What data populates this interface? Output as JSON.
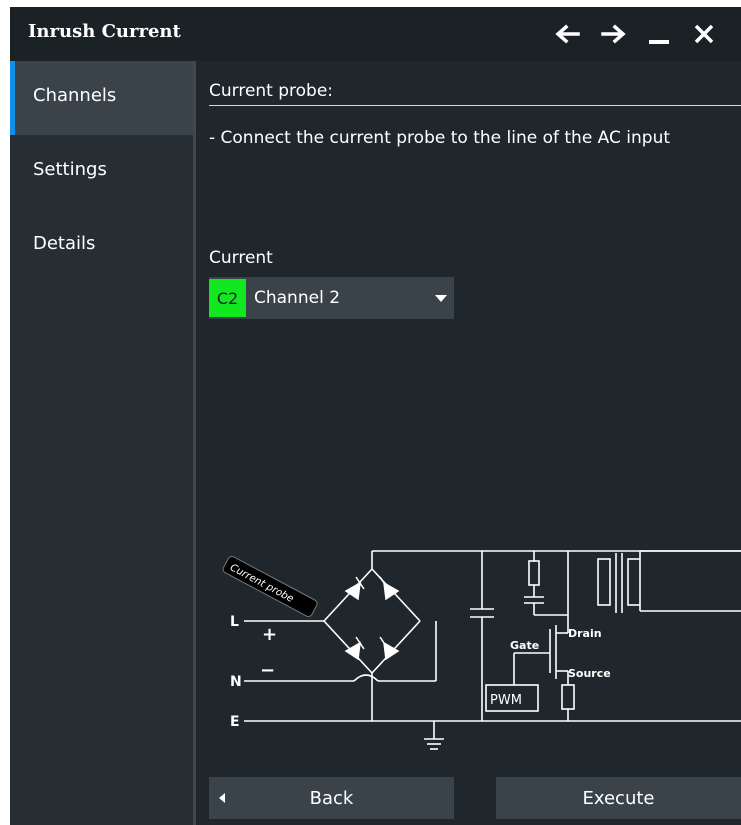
{
  "window": {
    "title": "Inrush Current",
    "controls": [
      "arrow-left-icon",
      "arrow-right-icon",
      "minimize-icon",
      "close-icon"
    ]
  },
  "sidebar": {
    "items": [
      {
        "label": "Channels",
        "active": true
      },
      {
        "label": "Settings",
        "active": false
      },
      {
        "label": "Details",
        "active": false
      }
    ]
  },
  "main": {
    "section_title": "Current probe:",
    "instruction": "- Connect the current probe to the line of the AC input",
    "current_label": "Current",
    "current_select": {
      "badge": "C2",
      "value": "Channel 2",
      "badge_color": "#11e81f"
    }
  },
  "diagram": {
    "probe_label": "Current probe",
    "terminal_l": "L",
    "terminal_n": "N",
    "terminal_e": "E",
    "plus": "+",
    "minus": "−",
    "gate": "Gate",
    "drain": "Drain",
    "source": "Source",
    "pwm": "PWM"
  },
  "footer": {
    "back_label": "Back",
    "execute_label": "Execute"
  },
  "colors": {
    "accent": "#0f8fe8",
    "channel2": "#11e81f",
    "background": "#1b2226"
  }
}
